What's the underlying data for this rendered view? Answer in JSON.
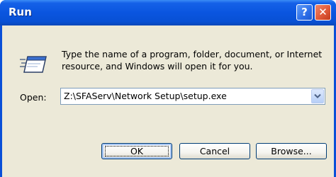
{
  "window": {
    "title": "Run",
    "help_glyph": "?",
    "close_glyph": "✕"
  },
  "dialog": {
    "icon": "run-icon",
    "description": "Type the name of a program, folder, document, or Internet resource, and Windows will open it for you.",
    "open_label": "Open:",
    "open_value": "Z:\\SFAServ\\Network Setup\\setup.exe"
  },
  "buttons": {
    "ok": "OK",
    "cancel": "Cancel",
    "browse": "Browse..."
  },
  "colors": {
    "titlebar": "#0a55df",
    "dialog_bg": "#ece9d8",
    "close_button": "#e05a3a",
    "button_border": "#003c74"
  }
}
